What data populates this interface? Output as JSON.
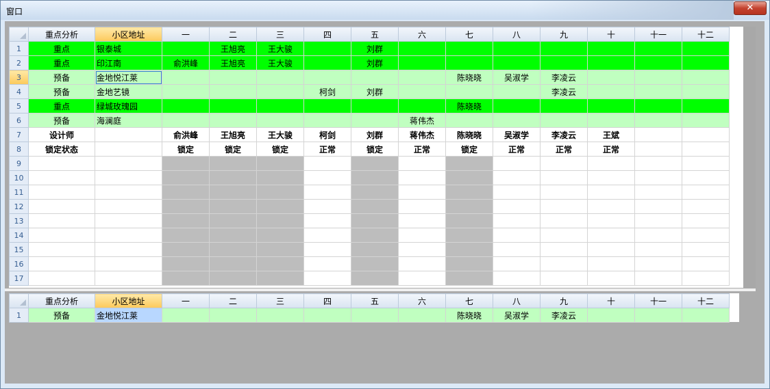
{
  "window": {
    "title": "窗口",
    "close_icon": "close-icon"
  },
  "columns": [
    "重点分析",
    "小区地址",
    "一",
    "二",
    "三",
    "四",
    "五",
    "六",
    "七",
    "八",
    "九",
    "十",
    "十一",
    "十二"
  ],
  "main_rows": [
    {
      "num": "1",
      "type": "bright",
      "cells": [
        "重点",
        "银泰城",
        "",
        "王旭亮",
        "王大骏",
        "",
        "刘群",
        "",
        "",
        "",
        "",
        "",
        "",
        ""
      ]
    },
    {
      "num": "2",
      "type": "bright",
      "cells": [
        "重点",
        "印江南",
        "俞洪峰",
        "王旭亮",
        "王大骏",
        "",
        "刘群",
        "",
        "",
        "",
        "",
        "",
        "",
        ""
      ]
    },
    {
      "num": "3",
      "type": "light",
      "cells": [
        "预备",
        "金地悦江莱",
        "",
        "",
        "",
        "",
        "",
        "",
        "陈晓晓",
        "吴淑学",
        "李凌云",
        "",
        "",
        ""
      ]
    },
    {
      "num": "4",
      "type": "light",
      "cells": [
        "预备",
        "金地艺镜",
        "",
        "",
        "",
        "柯剑",
        "刘群",
        "",
        "",
        "",
        "李凌云",
        "",
        "",
        ""
      ]
    },
    {
      "num": "5",
      "type": "bright",
      "cells": [
        "重点",
        "绿城玫瑰园",
        "",
        "",
        "",
        "",
        "",
        "",
        "陈晓晓",
        "",
        "",
        "",
        "",
        ""
      ]
    },
    {
      "num": "6",
      "type": "light",
      "cells": [
        "预备",
        "海澜庭",
        "",
        "",
        "",
        "",
        "",
        "蒋伟杰",
        "",
        "",
        "",
        "",
        "",
        ""
      ]
    },
    {
      "num": "7",
      "type": "bold",
      "cells": [
        "设计师",
        "",
        "俞洪峰",
        "王旭亮",
        "王大骏",
        "柯剑",
        "刘群",
        "蒋伟杰",
        "陈晓晓",
        "吴淑学",
        "李凌云",
        "王斌",
        "",
        ""
      ]
    },
    {
      "num": "8",
      "type": "bold",
      "cells": [
        "锁定状态",
        "",
        "锁定",
        "锁定",
        "锁定",
        "正常",
        "锁定",
        "正常",
        "锁定",
        "正常",
        "正常",
        "正常",
        "",
        ""
      ]
    },
    {
      "num": "9",
      "type": "empty",
      "cells": [
        "",
        "",
        "",
        "",
        "",
        "",
        "",
        "",
        "",
        "",
        "",
        "",
        "",
        ""
      ]
    },
    {
      "num": "10",
      "type": "empty",
      "cells": [
        "",
        "",
        "",
        "",
        "",
        "",
        "",
        "",
        "",
        "",
        "",
        "",
        "",
        ""
      ]
    },
    {
      "num": "11",
      "type": "empty",
      "cells": [
        "",
        "",
        "",
        "",
        "",
        "",
        "",
        "",
        "",
        "",
        "",
        "",
        "",
        ""
      ]
    },
    {
      "num": "12",
      "type": "empty",
      "cells": [
        "",
        "",
        "",
        "",
        "",
        "",
        "",
        "",
        "",
        "",
        "",
        "",
        "",
        ""
      ]
    },
    {
      "num": "13",
      "type": "empty",
      "cells": [
        "",
        "",
        "",
        "",
        "",
        "",
        "",
        "",
        "",
        "",
        "",
        "",
        "",
        ""
      ]
    },
    {
      "num": "14",
      "type": "empty",
      "cells": [
        "",
        "",
        "",
        "",
        "",
        "",
        "",
        "",
        "",
        "",
        "",
        "",
        "",
        ""
      ]
    },
    {
      "num": "15",
      "type": "empty",
      "cells": [
        "",
        "",
        "",
        "",
        "",
        "",
        "",
        "",
        "",
        "",
        "",
        "",
        "",
        ""
      ]
    },
    {
      "num": "16",
      "type": "empty",
      "cells": [
        "",
        "",
        "",
        "",
        "",
        "",
        "",
        "",
        "",
        "",
        "",
        "",
        "",
        ""
      ]
    },
    {
      "num": "17",
      "type": "empty",
      "cells": [
        "",
        "",
        "",
        "",
        "",
        "",
        "",
        "",
        "",
        "",
        "",
        "",
        "",
        ""
      ]
    }
  ],
  "locked_columns": [
    2,
    3,
    4,
    6,
    8
  ],
  "selected_row": "3",
  "detail_rows": [
    {
      "num": "1",
      "type": "light",
      "cells": [
        "预备",
        "金地悦江莱",
        "",
        "",
        "",
        "",
        "",
        "",
        "陈晓晓",
        "吴淑学",
        "李凌云",
        "",
        "",
        ""
      ]
    }
  ],
  "colors": {
    "key_row": "#00ff00",
    "reserve_row": "#c0ffc0",
    "locked": "#bdbdbd",
    "header_selected": "#fcc95b",
    "client_bg": "#ababab"
  }
}
